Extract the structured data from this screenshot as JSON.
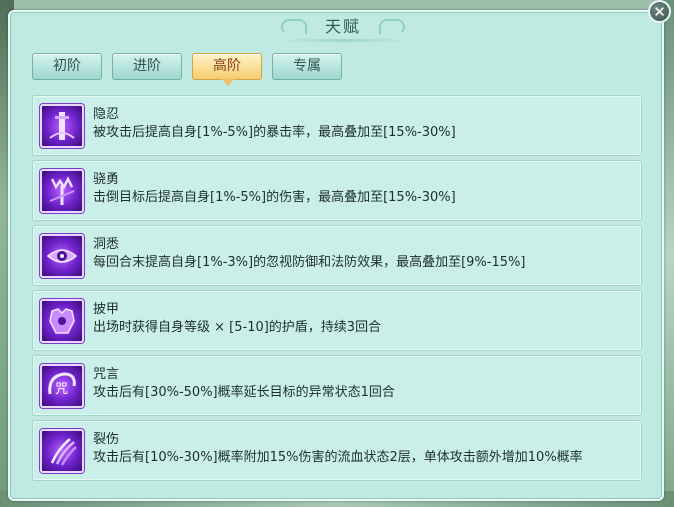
{
  "window": {
    "title": "天赋",
    "close_symbol": "✕"
  },
  "tabs": [
    {
      "label": "初阶",
      "active": false
    },
    {
      "label": "进阶",
      "active": false
    },
    {
      "label": "高阶",
      "active": true
    },
    {
      "label": "专属",
      "active": false
    }
  ],
  "talents": [
    {
      "name": "隐忍",
      "desc": "被攻击后提高自身[1%-5%]的暴击率，最高叠加至[15%-30%]",
      "icon": "pillar-light-icon"
    },
    {
      "name": "骁勇",
      "desc": "击倒目标后提高自身[1%-5%]的伤害，最高叠加至[15%-30%]",
      "icon": "trident-icon"
    },
    {
      "name": "洞悉",
      "desc": "每回合末提高自身[1%-3%]的忽视防御和法防效果，最高叠加至[9%-15%]",
      "icon": "eye-icon"
    },
    {
      "name": "披甲",
      "desc": "出场时获得自身等级 × [5-10]的护盾，持续3回合",
      "icon": "armor-icon"
    },
    {
      "name": "咒言",
      "desc": "攻击后有[30%-50%]概率延长目标的异常状态1回合",
      "icon": "curse-swirl-icon"
    },
    {
      "name": "裂伤",
      "desc": "攻击后有[10%-30%]概率附加15%伤害的流血状态2层，单体攻击额外增加10%概率",
      "icon": "claw-slash-icon"
    }
  ],
  "colors": {
    "panel_bg": "#bfe9e1",
    "tab_active": "#f5cc6e",
    "icon_purple": "#6c21c9"
  }
}
